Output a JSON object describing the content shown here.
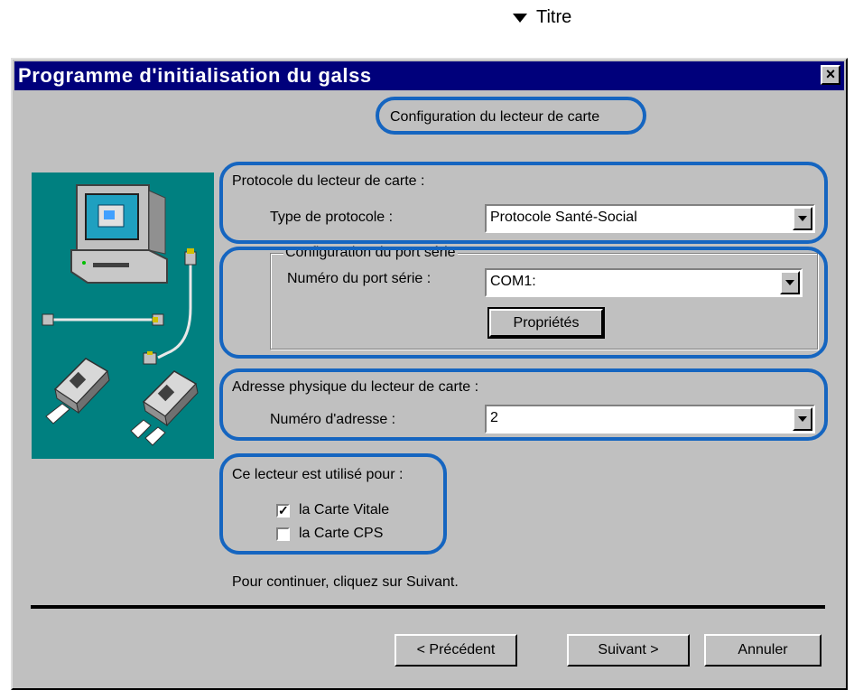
{
  "caption": {
    "label": "Titre"
  },
  "window": {
    "title": "Programme d'initialisation du galss",
    "close_glyph": "×",
    "heading": "Configuration du lecteur de carte"
  },
  "protocol": {
    "section_label": "Protocole du lecteur de carte :",
    "type_label": "Type de protocole :",
    "type_value": "Protocole Santé-Social"
  },
  "serial": {
    "group_label": "Configuration du port série",
    "port_label": "Numéro du port série :",
    "port_value": "COM1:",
    "properties_button": "Propriétés"
  },
  "address": {
    "section_label": "Adresse physique du lecteur de carte :",
    "number_label": "Numéro d'adresse :",
    "number_value": "2"
  },
  "usage": {
    "section_label": "Ce lecteur est utilisé pour :",
    "options": [
      {
        "label": "la Carte Vitale",
        "checked": true
      },
      {
        "label": "la Carte CPS",
        "checked": false
      }
    ]
  },
  "hint": "Pour continuer, cliquez sur Suivant.",
  "buttons": {
    "previous": "< Précédent",
    "next": "Suivant >",
    "cancel": "Annuler"
  },
  "colors": {
    "title_bar": "#00007b",
    "highlight": "#1565c0",
    "illustration_bg": "#008080"
  },
  "icons": [
    "dropdown-triangle-icon",
    "close-icon",
    "computer-illustration",
    "card-reader-icon"
  ]
}
